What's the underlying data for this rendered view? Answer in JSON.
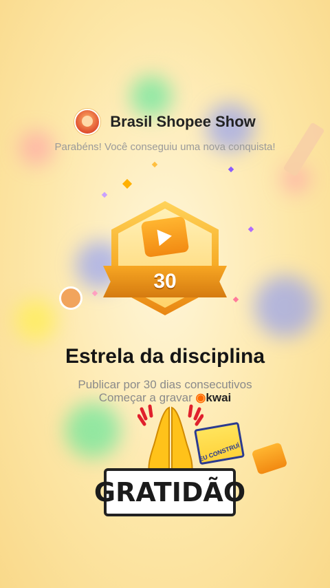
{
  "header": {
    "channel_name": "Brasil Shopee Show",
    "congrats": "Parabéns! Você conseguiu uma nova conquista!"
  },
  "badge": {
    "number": "30"
  },
  "achievement": {
    "title": "Estrela da disciplina",
    "description": "Publicar por 30 dias consecutivos",
    "cta_prefix": "Começar a gravar",
    "brand": "kwai"
  },
  "sticker": {
    "text": "GRATIDÃO",
    "badge_text": "EU CONSTRUÍ"
  },
  "icons": {
    "avatar": "bear-avatar",
    "badge": "hexagon-clapper-badge",
    "sticker_hands": "praying-hands"
  },
  "colors": {
    "background": "#fde7a8",
    "badge_gold": "#f6a923",
    "title_text": "#151515",
    "muted_text": "#8a8a8a",
    "brand_orange": "#ff6a00"
  }
}
